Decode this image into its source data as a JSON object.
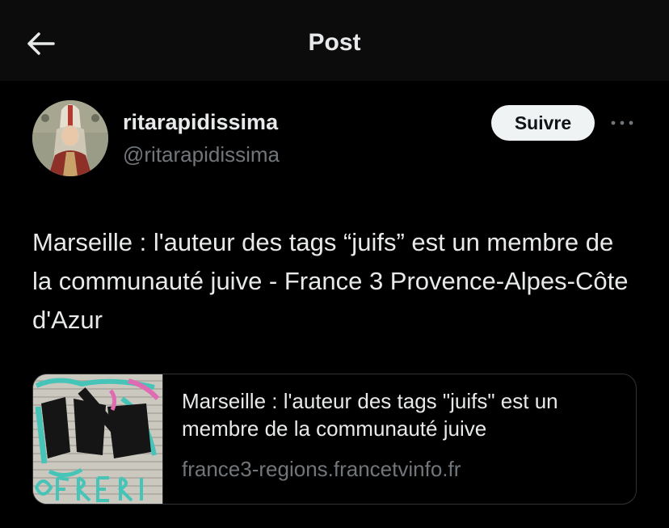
{
  "header": {
    "title": "Post",
    "back_icon": "arrow-left-icon"
  },
  "author": {
    "display_name": "ritarapidissima",
    "handle": "@ritarapidissima",
    "follow_label": "Suivre",
    "more_icon": "more-horizontal-icon"
  },
  "post": {
    "text": "Marseille : l'auteur des tags “juifs” est un membre de la communauté juive - France 3 Provence-Alpes-Côte d'Azur"
  },
  "link_card": {
    "title": "Marseille : l'auteur des tags \"juifs\" est un membre de la communauté juive",
    "domain": "france3-regions.francetvinfo.fr"
  },
  "colors": {
    "background": "#000000",
    "header_background": "#0c0c0c",
    "primary_text": "#e7e9ea",
    "secondary_text": "#71767b",
    "follow_button_bg": "#eff3f4",
    "border": "#2f3336"
  }
}
